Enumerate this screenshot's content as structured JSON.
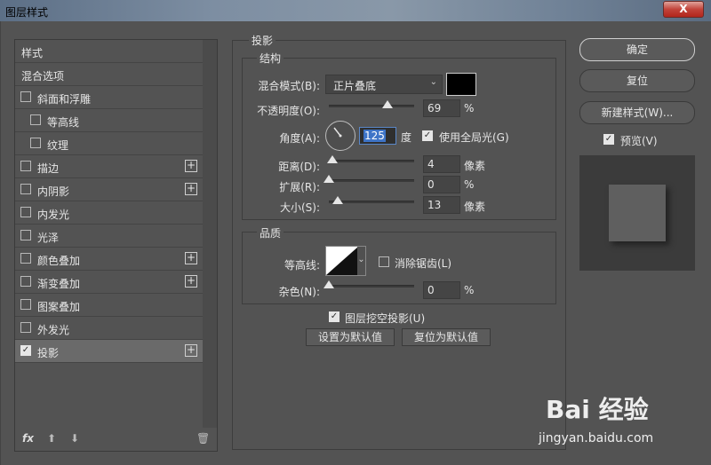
{
  "window": {
    "title": "图层样式",
    "close_label": "X"
  },
  "left": {
    "header_label": "样式",
    "blend_label": "混合选项",
    "items": [
      {
        "label": "斜面和浮雕",
        "checked": false,
        "plus": false,
        "indent": false
      },
      {
        "label": "等高线",
        "checked": false,
        "plus": false,
        "indent": true
      },
      {
        "label": "纹理",
        "checked": false,
        "plus": false,
        "indent": true
      },
      {
        "label": "描边",
        "checked": false,
        "plus": true,
        "indent": false
      },
      {
        "label": "内阴影",
        "checked": false,
        "plus": true,
        "indent": false
      },
      {
        "label": "内发光",
        "checked": false,
        "plus": false,
        "indent": false
      },
      {
        "label": "光泽",
        "checked": false,
        "plus": false,
        "indent": false
      },
      {
        "label": "颜色叠加",
        "checked": false,
        "plus": true,
        "indent": false
      },
      {
        "label": "渐变叠加",
        "checked": false,
        "plus": true,
        "indent": false
      },
      {
        "label": "图案叠加",
        "checked": false,
        "plus": false,
        "indent": false
      },
      {
        "label": "外发光",
        "checked": false,
        "plus": false,
        "indent": false
      },
      {
        "label": "投影",
        "checked": true,
        "plus": true,
        "indent": false,
        "selected": true
      }
    ],
    "bottom": {
      "fx_label": "fx",
      "up_label": "⬆",
      "down_label": "⬇",
      "trash_label": "🗑"
    }
  },
  "shadow": {
    "title": "投影",
    "structure": {
      "title": "结构",
      "blend_mode_label": "混合模式(B):",
      "blend_mode_value": "正片叠底",
      "shadow_color": "#000000",
      "opacity_label": "不透明度(O):",
      "opacity_value": "69",
      "opacity_unit": "%",
      "angle_label": "角度(A):",
      "angle_value": "125",
      "angle_unit": "度",
      "global_light_label": "使用全局光(G)",
      "global_light_checked": true,
      "distance_label": "距离(D):",
      "distance_value": "4",
      "distance_unit": "像素",
      "spread_label": "扩展(R):",
      "spread_value": "0",
      "spread_unit": "%",
      "size_label": "大小(S):",
      "size_value": "13",
      "size_unit": "像素"
    },
    "quality": {
      "title": "品质",
      "contour_label": "等高线:",
      "antialias_label": "消除锯齿(L)",
      "antialias_checked": false,
      "noise_label": "杂色(N):",
      "noise_value": "0",
      "noise_unit": "%"
    },
    "knockout_label": "图层挖空投影(U)",
    "knockout_checked": true,
    "set_default_label": "设置为默认值",
    "reset_default_label": "复位为默认值"
  },
  "buttons": {
    "ok": "确定",
    "reset": "复位",
    "new_style": "新建样式(W)...",
    "preview_label": "预览(V)",
    "preview_checked": true
  },
  "watermark": {
    "brand": "Bai 经验",
    "url": "jingyan.baidu.com"
  }
}
